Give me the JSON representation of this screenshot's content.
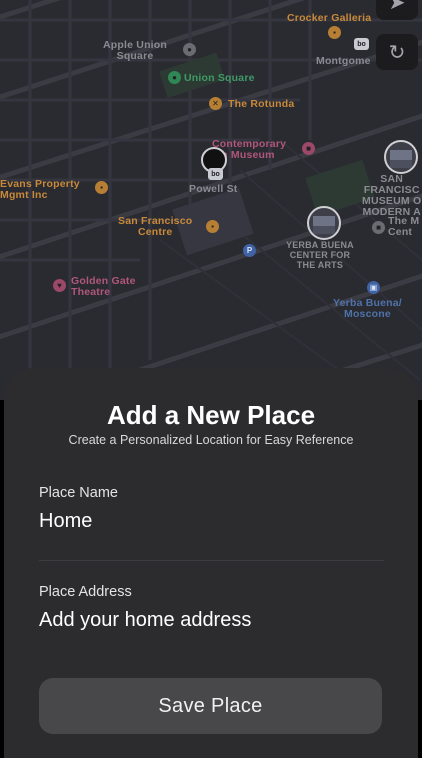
{
  "map": {
    "labels": {
      "crocker_galleria": "Crocker Galleria",
      "apple_union_square_1": "Apple Union",
      "apple_union_square_2": "Square",
      "union_square": "Union Square",
      "montgomery": "Montgome",
      "the_rotunda": "The Rotunda",
      "contemporary_1": "Contemporary",
      "contemporary_2": "ish Museum",
      "evans_1": "Evans Property",
      "evans_2": "Mgmt Inc",
      "powell_st": "Powell St",
      "sf_centre_1": "San Francisco",
      "sf_centre_2": "Centre",
      "yerba_center_1": "YERBA BUENA",
      "yerba_center_2": "CENTER FOR",
      "yerba_center_3": "THE ARTS",
      "sf_museum_1": "SAN",
      "sf_museum_2": "FRANCISC",
      "sf_museum_3": "MUSEUM O",
      "sf_museum_4": "MODERN A",
      "the_mo_1": "The M",
      "the_mo_2": "Cent",
      "golden_gate_1": "Golden Gate",
      "golden_gate_2": "Theatre",
      "yerba_moscone_1": "Yerba Buena/",
      "yerba_moscone_2": "Moscone",
      "transit_badge": "bo",
      "parking": "P"
    },
    "icons": {
      "location": "navigation-arrow-icon",
      "refresh": "refresh-icon"
    }
  },
  "sheet": {
    "title": "Add a New Place",
    "subtitle": "Create a Personalized Location for Easy Reference",
    "place_name_label": "Place Name",
    "place_name_value": "Home",
    "place_address_label": "Place Address",
    "place_address_placeholder": "Add your home address",
    "save_label": "Save Place"
  },
  "colors": {
    "sheet_bg": "#2c2c2e",
    "button_bg": "#48484b",
    "map_bg": "#2a2a31"
  }
}
